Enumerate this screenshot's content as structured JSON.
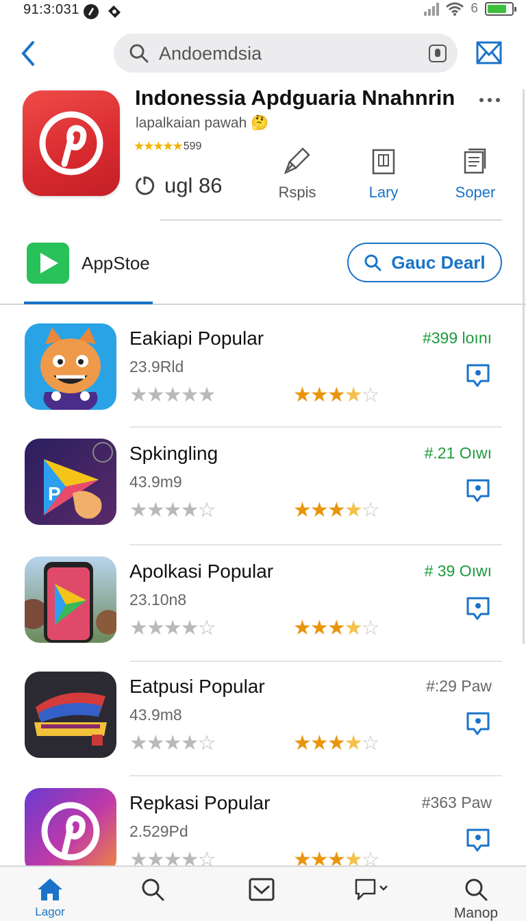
{
  "status_bar": {
    "time": "91:3:031",
    "network": "6",
    "battery_level": 0.8,
    "battery_color": "#3cbf3c"
  },
  "search": {
    "value": "Andoemdsia",
    "icons": [
      "back-arrow-icon",
      "search-icon",
      "mic-icon",
      "mail-icon"
    ]
  },
  "featured": {
    "title": "Indonessia Apdguaria Nnahnrin",
    "subtitle": "lapalkaian pawah 🤔",
    "stars": "★★★★★",
    "rating": "599",
    "timer": "ugl 86",
    "actions": [
      {
        "label": "Rspis",
        "icon": "brush-icon",
        "color": "grey"
      },
      {
        "label": "Lary",
        "icon": "book-icon",
        "color": "blue"
      },
      {
        "label": "Soper",
        "icon": "document-icon",
        "color": "blue"
      }
    ]
  },
  "source": {
    "store_label": "AppStoe",
    "get_button_label": "Gauc Dearl"
  },
  "apps": [
    {
      "name": "Eakiapi Popular",
      "size": "23.9Rld",
      "rank": "#399 loını",
      "rank_color": "green",
      "grey_stars": "★★★★★",
      "gold_rating": 3.5
    },
    {
      "name": "Spkingling",
      "size": "43.9m9",
      "rank": "#.21 Oıwı",
      "rank_color": "green",
      "grey_stars": "★★★★☆",
      "gold_rating": 3.5
    },
    {
      "name": "Apolkasi Popular",
      "size": "23.10n8",
      "rank": "# 39 Oıwı",
      "rank_color": "green",
      "grey_stars": "★★★★☆",
      "gold_rating": 3.5
    },
    {
      "name": "Eatpusi Popular",
      "size": "43.9m8",
      "rank": "#:29 Paw",
      "rank_color": "grey",
      "grey_stars": "★★★★☆",
      "gold_rating": 3.5
    },
    {
      "name": "Repkasi Popular",
      "size": "2.529Pd",
      "rank": "#363 Paw",
      "rank_color": "grey",
      "grey_stars": "★★★★☆",
      "gold_rating": 3.5
    }
  ],
  "bottom_nav": [
    {
      "label": "Lagor",
      "icon": "home-icon",
      "active": true
    },
    {
      "label": "",
      "icon": "search-icon",
      "active": false
    },
    {
      "label": "",
      "icon": "mail-icon",
      "active": false
    },
    {
      "label": "",
      "icon": "chat-icon",
      "active": false
    },
    {
      "label": "Manop",
      "icon": "search-icon",
      "active": false
    }
  ],
  "colors": {
    "accent": "#1a73c9",
    "rank_green": "#1c9a3c",
    "star_gold": "#e9950c"
  }
}
